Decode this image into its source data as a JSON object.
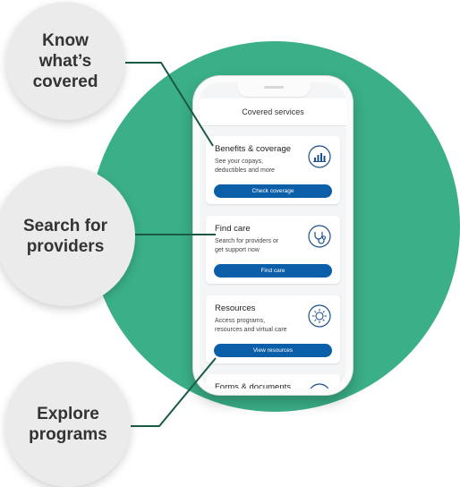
{
  "callouts": [
    {
      "label": "Know\nwhat’s\ncovered"
    },
    {
      "label": "Search for\nproviders"
    },
    {
      "label": "Explore\nprograms"
    }
  ],
  "phone": {
    "header_title": "Covered services",
    "cards": [
      {
        "title": "Benefits & coverage",
        "description": "See your copays,\ndeductibles and more",
        "button": "Check coverage",
        "icon": "bar-chart-icon"
      },
      {
        "title": "Find care",
        "description": "Search for providers or\nget support now",
        "button": "Find care",
        "icon": "stethoscope-icon"
      },
      {
        "title": "Resources",
        "description": "Access programs,\nresources and virtual care",
        "button": "View resources",
        "icon": "sun-icon"
      },
      {
        "title": "Forms & documents",
        "icon": "document-icon"
      }
    ]
  },
  "colors": {
    "accent_green": "#3aaf88",
    "button_blue": "#0b5ea8",
    "icon_blue": "#1b4f8a"
  }
}
